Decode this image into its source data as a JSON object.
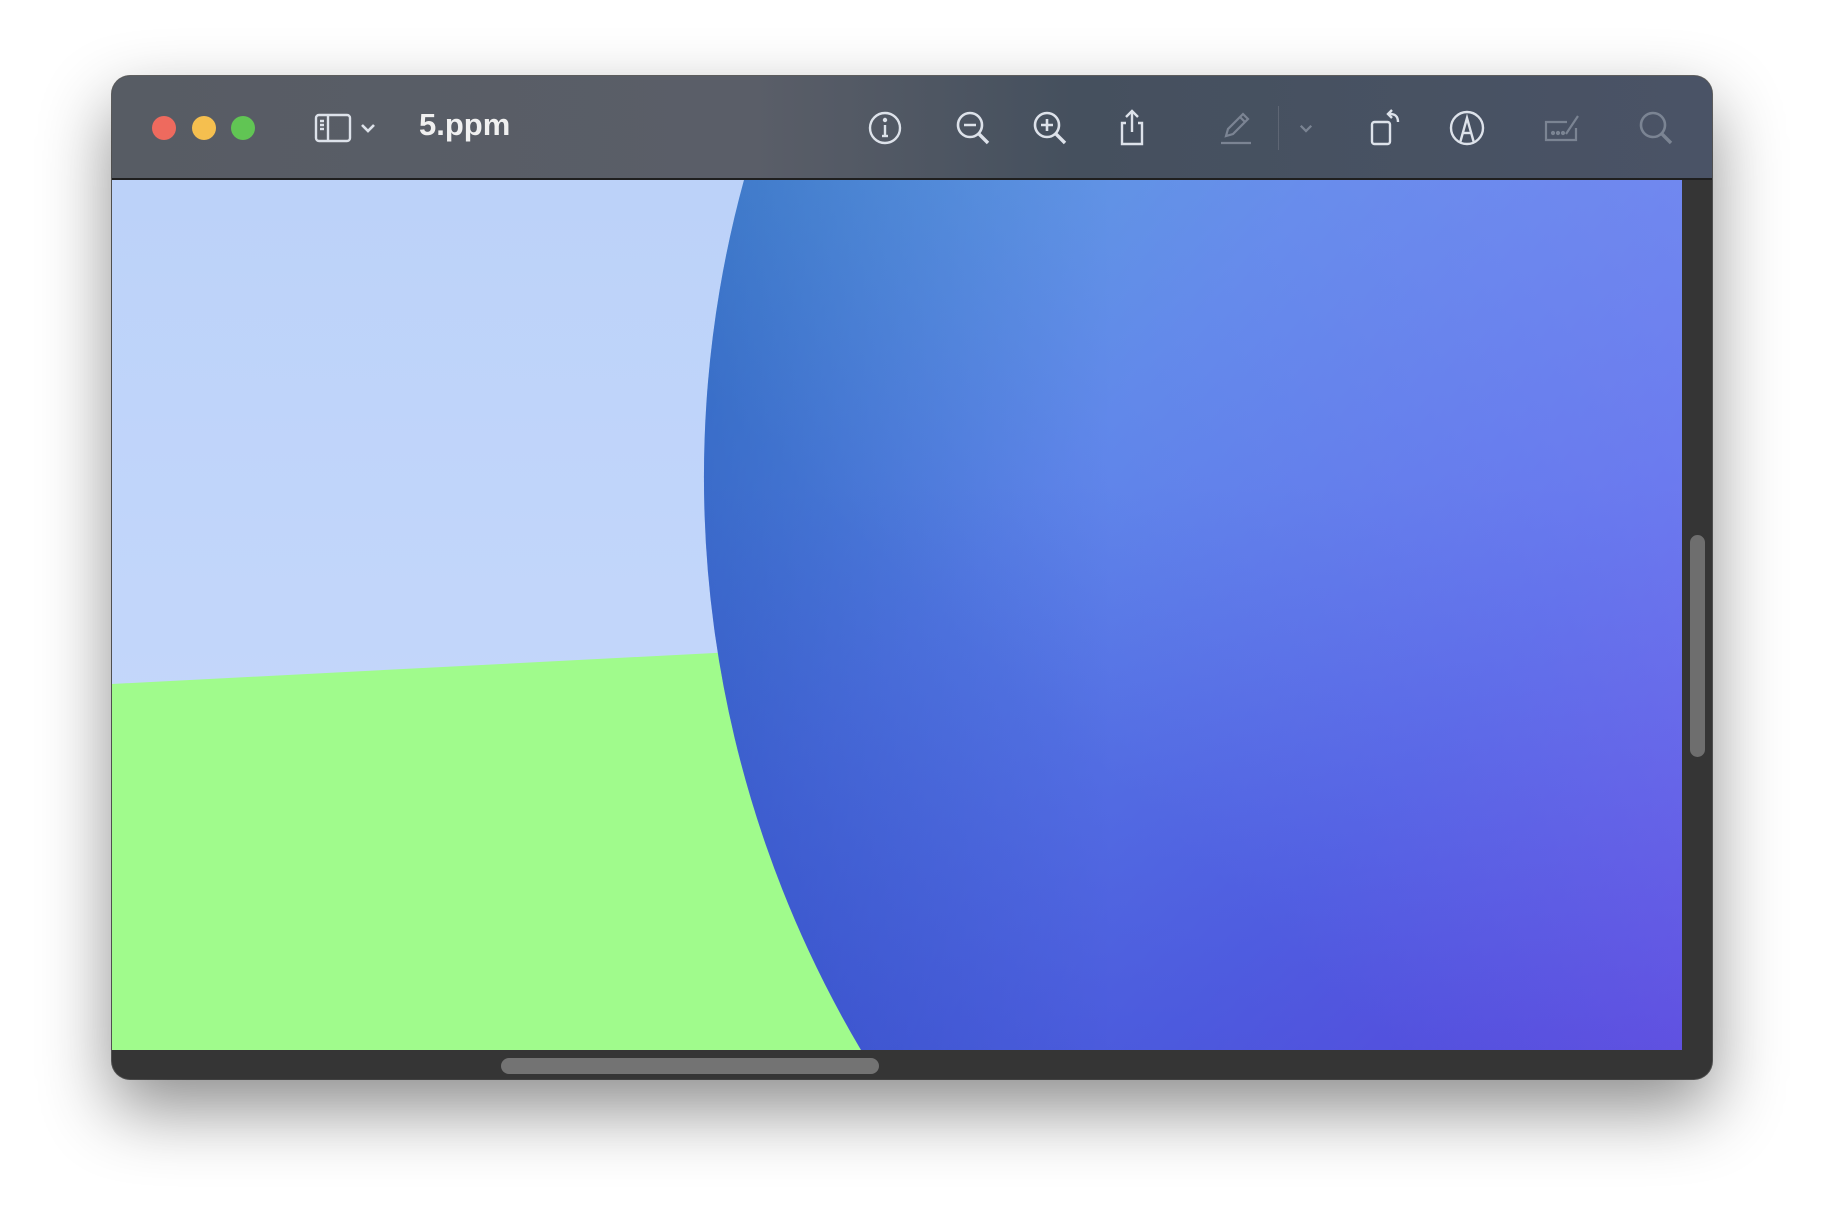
{
  "window": {
    "title": "5.ppm",
    "traffic_lights": {
      "close": "#ee6a5e",
      "minimize": "#f5bf4f",
      "zoom": "#61c554"
    }
  },
  "toolbar": {
    "left": [
      {
        "name": "sidebar-toggle",
        "icon": "sidebar-icon"
      },
      {
        "name": "sidebar-menu",
        "icon": "chevron-down-icon"
      }
    ],
    "right": [
      {
        "name": "info",
        "icon": "info-icon",
        "enabled": true
      },
      {
        "name": "zoom-out",
        "icon": "zoom-out-icon",
        "enabled": true
      },
      {
        "name": "zoom-in",
        "icon": "zoom-in-icon",
        "enabled": true
      },
      {
        "name": "share",
        "icon": "share-icon",
        "enabled": true
      },
      {
        "name": "highlight",
        "icon": "pen-icon",
        "enabled": false
      },
      {
        "name": "highlight-menu",
        "icon": "chevron-down-icon",
        "enabled": false
      },
      {
        "name": "rotate",
        "icon": "rotate-left-icon",
        "enabled": true
      },
      {
        "name": "markup",
        "icon": "markup-icon",
        "enabled": true
      },
      {
        "name": "fill-sign",
        "icon": "signature-icon",
        "enabled": false
      },
      {
        "name": "search",
        "icon": "search-icon",
        "enabled": false
      }
    ]
  },
  "image": {
    "colors": {
      "sky": "#c0d4fa",
      "ground": "#a0fb8c",
      "sphere_light": "#4fa0d6",
      "sphere_mid": "#5a78e8",
      "sphere_dark": "#2f46c6",
      "sphere_far": "#7a5ef0"
    }
  },
  "scrollbars": {
    "vertical_position": 0.45,
    "horizontal_position": 0.3
  }
}
